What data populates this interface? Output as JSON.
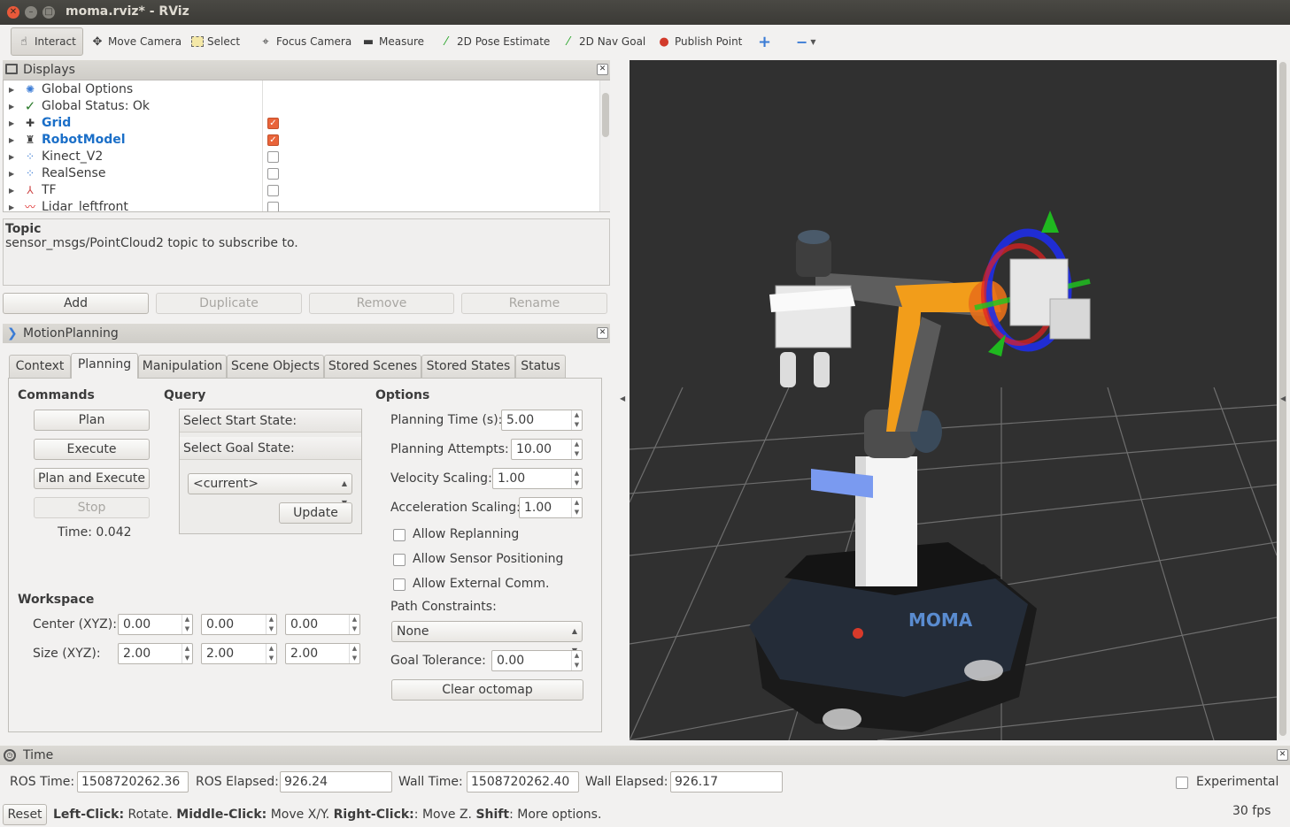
{
  "window": {
    "title": "moma.rviz* - RViz"
  },
  "toolbar": {
    "interact": "Interact",
    "move_camera": "Move Camera",
    "select": "Select",
    "focus_camera": "Focus Camera",
    "measure": "Measure",
    "pose_estimate": "2D Pose Estimate",
    "nav_goal": "2D Nav Goal",
    "publish_point": "Publish Point"
  },
  "displays": {
    "title": "Displays",
    "items": [
      {
        "label": "Global Options",
        "icon": "gear-icon",
        "checked": null,
        "highlight": false
      },
      {
        "label": "Global Status: Ok",
        "icon": "check-icon",
        "checked": null,
        "highlight": false
      },
      {
        "label": "Grid",
        "icon": "grid-icon",
        "checked": true,
        "highlight": true
      },
      {
        "label": "RobotModel",
        "icon": "robot-icon",
        "checked": true,
        "highlight": true
      },
      {
        "label": "Kinect_V2",
        "icon": "pointcloud-icon",
        "checked": false,
        "highlight": false
      },
      {
        "label": "RealSense",
        "icon": "pointcloud-icon",
        "checked": false,
        "highlight": false
      },
      {
        "label": "TF",
        "icon": "tf-icon",
        "checked": false,
        "highlight": false
      },
      {
        "label": "Lidar_leftfront",
        "icon": "laser-icon",
        "checked": false,
        "highlight": false
      }
    ],
    "description_title": "Topic",
    "description_text": "sensor_msgs/PointCloud2 topic to subscribe to.",
    "buttons": {
      "add": "Add",
      "duplicate": "Duplicate",
      "remove": "Remove",
      "rename": "Rename"
    }
  },
  "motion_planning": {
    "title": "MotionPlanning",
    "tabs": [
      "Context",
      "Planning",
      "Manipulation",
      "Scene Objects",
      "Stored Scenes",
      "Stored States",
      "Status"
    ],
    "active_tab": "Planning",
    "commands": {
      "heading": "Commands",
      "plan": "Plan",
      "execute": "Execute",
      "plan_and_execute": "Plan and Execute",
      "stop": "Stop",
      "time": "Time: 0.042"
    },
    "query": {
      "heading": "Query",
      "start_state": "Select Start State:",
      "goal_state": "Select Goal State:",
      "goal_value": "<current>",
      "update": "Update"
    },
    "options": {
      "heading": "Options",
      "planning_time_label": "Planning Time (s):",
      "planning_time": "5.00",
      "planning_attempts_label": "Planning Attempts:",
      "planning_attempts": "10.00",
      "velocity_scaling_label": "Velocity Scaling:",
      "velocity_scaling": "1.00",
      "acceleration_scaling_label": "Acceleration Scaling:",
      "acceleration_scaling": "1.00",
      "allow_replanning": "Allow Replanning",
      "allow_sensor_positioning": "Allow Sensor Positioning",
      "allow_external_comm": "Allow External Comm.",
      "path_constraints_label": "Path Constraints:",
      "path_constraints": "None",
      "goal_tolerance_label": "Goal Tolerance:",
      "goal_tolerance": "0.00",
      "clear_octomap": "Clear octomap"
    },
    "workspace": {
      "heading": "Workspace",
      "center_label": "Center (XYZ):",
      "center": [
        "0.00",
        "0.00",
        "0.00"
      ],
      "size_label": "Size (XYZ):",
      "size": [
        "2.00",
        "2.00",
        "2.00"
      ]
    }
  },
  "time_panel": {
    "title": "Time",
    "ros_time_label": "ROS Time:",
    "ros_time": "1508720262.36",
    "ros_elapsed_label": "ROS Elapsed:",
    "ros_elapsed": "926.24",
    "wall_time_label": "Wall Time:",
    "wall_time": "1508720262.40",
    "wall_elapsed_label": "Wall Elapsed:",
    "wall_elapsed": "926.17",
    "experimental": "Experimental"
  },
  "status": {
    "reset": "Reset",
    "left_click_key": "Left-Click:",
    "left_click_text": " Rotate. ",
    "middle_click_key": "Middle-Click:",
    "middle_click_text": " Move X/Y. ",
    "right_click_key": "Right-Click:",
    "right_click_text": ": Move Z. ",
    "shift_key": "Shift",
    "shift_text": ": More options.",
    "fps": "30 fps"
  },
  "viewport": {
    "base_logo": "MOMA"
  },
  "colors": {
    "accent_orange": "#e9643a",
    "highlight_blue": "#1b6fc8",
    "viewport_bg": "#303030"
  }
}
